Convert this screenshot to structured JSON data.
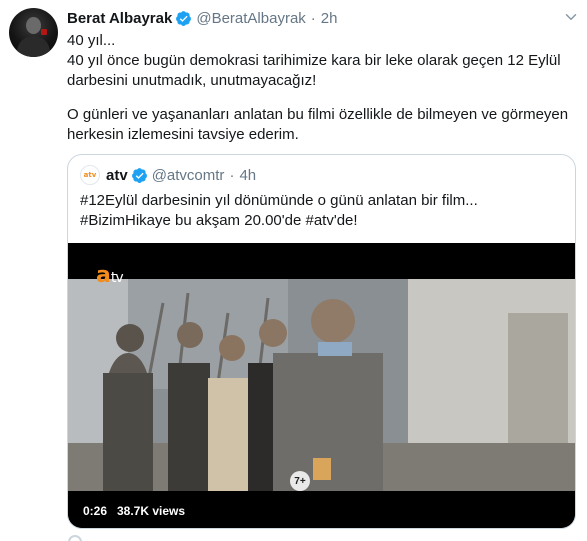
{
  "tweet": {
    "author_name": "Berat Albayrak",
    "author_handle": "@BeratAlbayrak",
    "separator": "·",
    "time": "2h",
    "lines": [
      "40 yıl...",
      "40 yıl önce bugün demokrasi tarihimize kara bir leke olarak geçen 12 Eylül",
      "darbesini unutmadık, unutmayacağız!",
      "O günleri ve yaşananları anlatan bu filmi özellikle de bilmeyen ve görmeyen",
      "herkesin izlemesini tavsiye ederim."
    ]
  },
  "quoted_tweet": {
    "author_name": "atv",
    "author_handle": "@atvcomtr",
    "separator": "·",
    "time": "4h",
    "logo_text": "atv",
    "lines": [
      "#12Eylül darbesinin yıl dönümünde o günü anlatan bir film...",
      "#BizimHikaye bu akşam 20.00'de #atv'de!"
    ],
    "video": {
      "watermark_a": "a",
      "watermark_tv": "tv",
      "age_rating": "7+",
      "duration": "0:26",
      "views": "38.7K views"
    }
  },
  "icons": {
    "verified": "verified-badge-icon",
    "more": "chevron-down-icon"
  },
  "colors": {
    "verified_blue": "#1da1f2",
    "secondary_text": "#657786",
    "border": "#ccd6dd",
    "atv_orange": "#f28c1c"
  }
}
